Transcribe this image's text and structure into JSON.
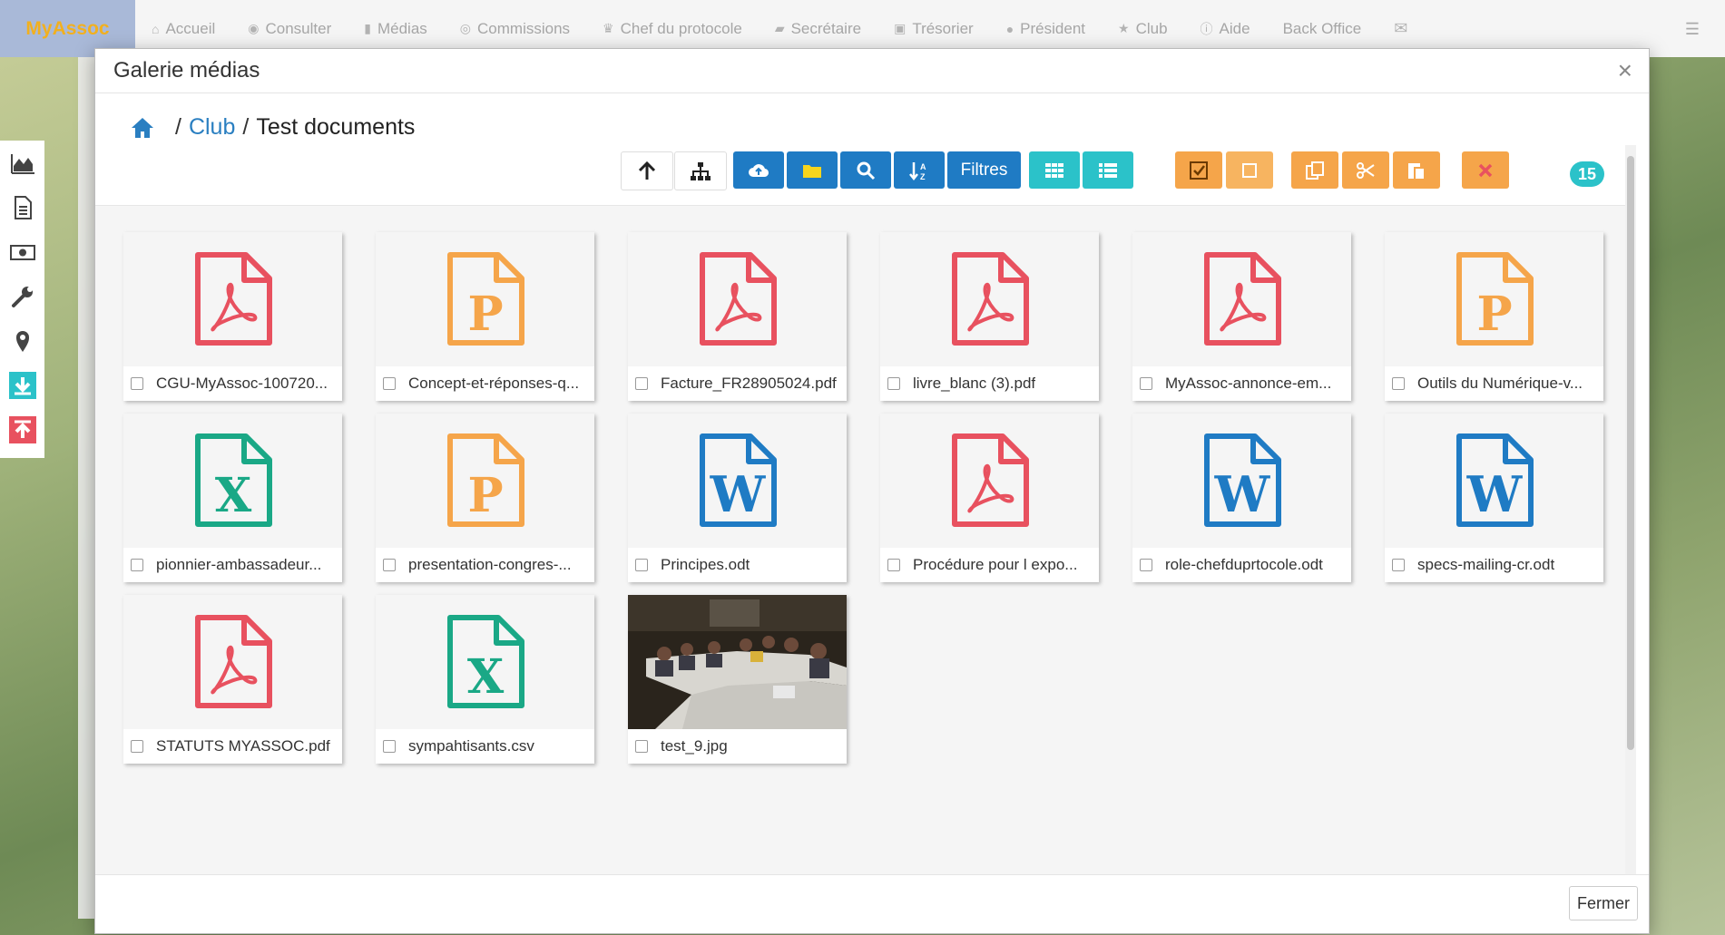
{
  "app": {
    "brand": "MyAssoc"
  },
  "nav": {
    "items": [
      {
        "label": "Accueil",
        "icon": "home-icon"
      },
      {
        "label": "Consulter",
        "icon": "eye-icon"
      },
      {
        "label": "Médias",
        "icon": "file-icon"
      },
      {
        "label": "Commissions",
        "icon": "user-circle-icon"
      },
      {
        "label": "Chef du protocole",
        "icon": "trophy-icon"
      },
      {
        "label": "Secrétaire",
        "icon": "book-icon"
      },
      {
        "label": "Trésorier",
        "icon": "money-icon"
      },
      {
        "label": "Président",
        "icon": "globe-icon"
      },
      {
        "label": "Club",
        "icon": "star-icon"
      },
      {
        "label": "Aide",
        "icon": "info-icon"
      },
      {
        "label": "Back Office",
        "icon": ""
      }
    ]
  },
  "modal": {
    "title": "Galerie médias",
    "close_symbol": "×",
    "breadcrumb": {
      "separator": "/",
      "parent": "Club",
      "current": "Test documents"
    },
    "toolbar": {
      "filters_label": "Filtres",
      "count": "15"
    },
    "footer": {
      "close_label": "Fermer"
    },
    "files": [
      {
        "name": "CGU-MyAssoc-100720...",
        "type": "pdf"
      },
      {
        "name": "Concept-et-réponses-q...",
        "type": "ppt"
      },
      {
        "name": "Facture_FR28905024.pdf",
        "type": "pdf"
      },
      {
        "name": "livre_blanc (3).pdf",
        "type": "pdf"
      },
      {
        "name": "MyAssoc-annonce-em...",
        "type": "pdf"
      },
      {
        "name": "Outils du Numérique-v...",
        "type": "ppt"
      },
      {
        "name": "pionnier-ambassadeur...",
        "type": "xls"
      },
      {
        "name": "presentation-congres-...",
        "type": "ppt"
      },
      {
        "name": "Principes.odt",
        "type": "doc"
      },
      {
        "name": "Procédure pour l expo...",
        "type": "pdf"
      },
      {
        "name": "role-chefduprtocole.odt",
        "type": "doc"
      },
      {
        "name": "specs-mailing-cr.odt",
        "type": "doc"
      },
      {
        "name": "STATUTS MYASSOC.pdf",
        "type": "pdf"
      },
      {
        "name": "sympahtisants.csv",
        "type": "xls"
      },
      {
        "name": "test_9.jpg",
        "type": "img"
      }
    ]
  },
  "colors": {
    "pdf": "#e8515f",
    "ppt": "#f5a54a",
    "xls": "#1aa886",
    "doc": "#1f7bc4",
    "accent": "#2bc2c9"
  }
}
